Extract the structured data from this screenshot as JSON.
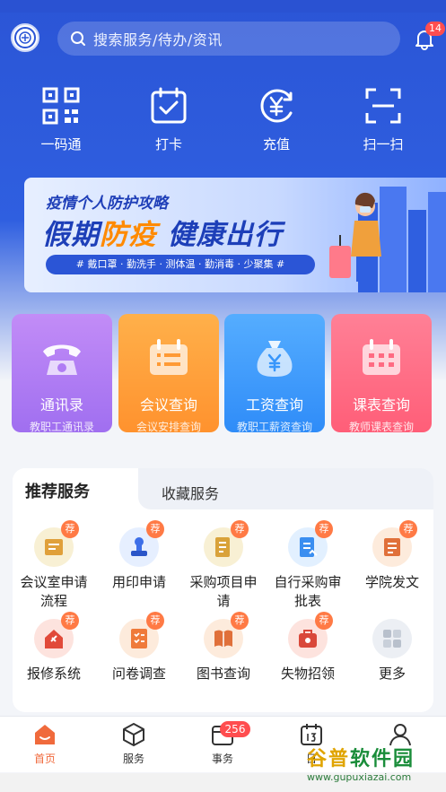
{
  "header": {
    "search_placeholder": "搜索服务/待办/资讯",
    "notification_count": "14"
  },
  "quick_actions": [
    {
      "label": "一码通",
      "icon": "qr-code-icon"
    },
    {
      "label": "打卡",
      "icon": "checkin-icon"
    },
    {
      "label": "充值",
      "icon": "recharge-icon"
    },
    {
      "label": "扫一扫",
      "icon": "scan-icon"
    }
  ],
  "banner": {
    "line1": "疫情个人防护攻略",
    "line2_a": "假期",
    "line2_b": "防疫",
    "line2_c": "健康出行",
    "tags": "# 戴口罩 · 勤洗手 · 测体温 · 勤消毒 · 少聚集 #"
  },
  "feature_cards": [
    {
      "title": "通讯录",
      "subtitle": "教职工通讯录",
      "color": "#b57cf5"
    },
    {
      "title": "会议查询",
      "subtitle": "会议安排查询",
      "color": "#ffa23a"
    },
    {
      "title": "工资查询",
      "subtitle": "教职工薪资查询",
      "color": "#3d9cff"
    },
    {
      "title": "课表查询",
      "subtitle": "教师课表查询",
      "color": "#ff6f86"
    }
  ],
  "services": {
    "tab_active": "推荐服务",
    "tab_inactive": "收藏服务",
    "badge": "荐",
    "items": [
      {
        "line1": "会议室申请",
        "line2": "流程",
        "icon": "meeting-room-icon"
      },
      {
        "line1": "用印申请",
        "line2": "",
        "icon": "seal-icon"
      },
      {
        "line1": "采购项目申",
        "line2": "请",
        "icon": "purchase-icon"
      },
      {
        "line1": "自行采购审",
        "line2": "批表",
        "icon": "approval-icon"
      },
      {
        "line1": "学院发文",
        "line2": "",
        "icon": "document-icon"
      },
      {
        "line1": "报修系统",
        "line2": "",
        "icon": "repair-icon"
      },
      {
        "line1": "问卷调查",
        "line2": "",
        "icon": "survey-icon"
      },
      {
        "line1": "图书查询",
        "line2": "",
        "icon": "book-icon"
      },
      {
        "line1": "失物招领",
        "line2": "",
        "icon": "lost-found-icon"
      },
      {
        "line1": "更多",
        "line2": "",
        "icon": "more-icon"
      }
    ]
  },
  "tabbar": {
    "items": [
      {
        "label": "首页",
        "icon": "home-icon"
      },
      {
        "label": "服务",
        "icon": "service-icon"
      },
      {
        "label": "事务",
        "icon": "task-icon"
      },
      {
        "label": "日",
        "icon": "calendar-icon"
      },
      {
        "label": "",
        "icon": "profile-icon"
      }
    ],
    "task_badge": "256"
  },
  "watermark": {
    "brand_a": "谷普",
    "brand_b": "软件园",
    "url": "www.gupuxiazai.com"
  }
}
